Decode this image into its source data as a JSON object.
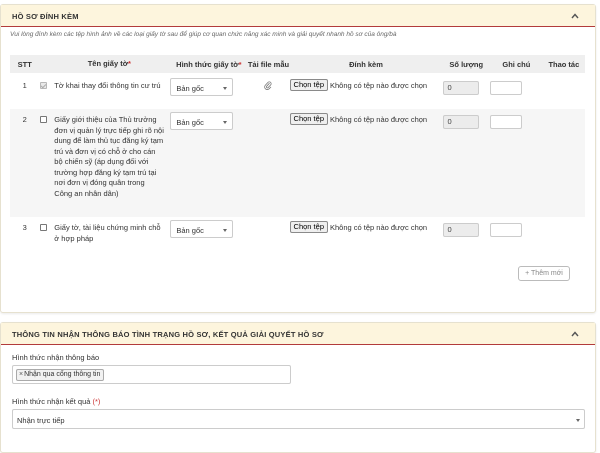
{
  "section1": {
    "title": "HỒ SƠ ĐÍNH KÈM",
    "hint": "Vui lòng đính kèm các tệp hình ảnh về các loại giấy tờ sau để giúp cơ quan chức năng xác minh và giải quyết nhanh hồ sơ của ông/bà",
    "columns": {
      "stt": "STT",
      "name": "Tên giấy tờ",
      "form": "Hình thức giấy tờ",
      "template": "Tải file mẫu",
      "attach": "Đính kèm",
      "qty": "Số lượng",
      "note": "Ghi chú",
      "action": "Thao tác"
    },
    "required_mark": "*",
    "rows": [
      {
        "stt": "1",
        "checkbox_disabled": true,
        "name": "Tờ khai thay đổi thông tin cư trú",
        "form": "Bản gốc",
        "choose_file": "Chọn tệp",
        "no_file": "Không có tệp nào được chọn",
        "qty": "0",
        "has_template_icon": true
      },
      {
        "stt": "2",
        "checkbox_disabled": false,
        "name": "Giấy giới thiệu của Thủ trưởng đơn vị quản lý trực tiếp ghi rõ nội dung để làm thủ tục đăng ký tạm trú và đơn vị có chỗ ở cho cán bộ chiến sỹ (áp dụng đối với trường hợp đăng ký tạm trú tại nơi đơn vị đóng quân trong Công an nhân dân)",
        "form": "Bản gốc",
        "choose_file": "Chọn tệp",
        "no_file": "Không có tệp nào được chọn",
        "qty": "0",
        "has_template_icon": false
      },
      {
        "stt": "3",
        "checkbox_disabled": false,
        "name": "Giấy tờ, tài liệu chứng minh chỗ ở hợp pháp",
        "form": "Bản gốc",
        "choose_file": "Chọn tệp",
        "no_file": "Không có tệp nào được chọn",
        "qty": "0",
        "has_template_icon": false
      }
    ],
    "add_button": "+ Thêm mới"
  },
  "section2": {
    "title": "THÔNG TIN NHẬN THÔNG BÁO TÌNH TRẠNG HỒ SƠ, KẾT QUẢ GIẢI QUYẾT HỒ SƠ",
    "notify_label": "Hình thức nhận thông báo",
    "notify_tag": "Nhận qua cổng thông tin",
    "notify_tag_remove": "×",
    "result_label": "Hình thức nhận kết quả",
    "result_required": "(*)",
    "result_value": "Nhận trực tiếp"
  },
  "colors": {
    "header_bg": "#fdf5dd",
    "header_border": "#b23b3b",
    "required": "#cc3333"
  },
  "icons": [
    "chevron-up-icon",
    "paperclip-icon",
    "caret-down-icon"
  ]
}
